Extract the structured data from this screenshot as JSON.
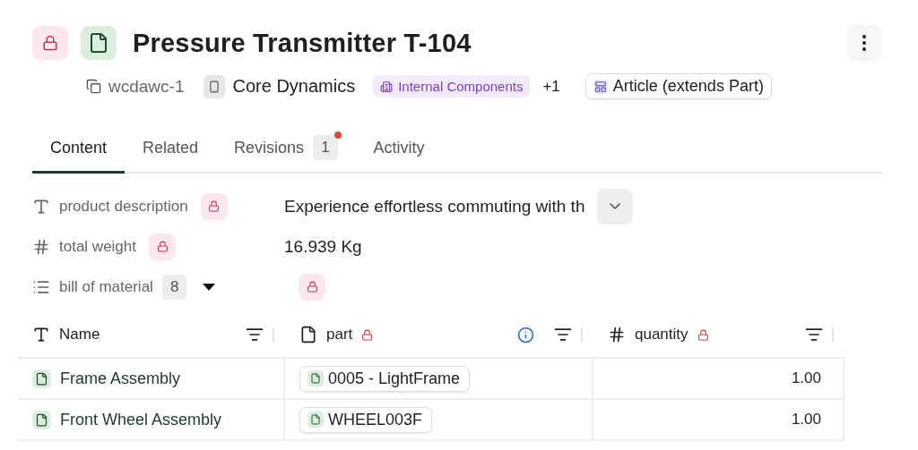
{
  "header": {
    "locked": true,
    "title": "Pressure Transmitter T-104"
  },
  "meta": {
    "id": "wcdawc-1",
    "company": "Core Dynamics",
    "tag": "Internal Components",
    "more": "+1",
    "type": "Article (extends Part)"
  },
  "tabs": [
    {
      "label": "Content",
      "selected": true
    },
    {
      "label": "Related",
      "selected": false
    },
    {
      "label": "Revisions",
      "selected": false,
      "count": "1",
      "notification": true
    },
    {
      "label": "Activity",
      "selected": false
    }
  ],
  "fields": [
    {
      "kind": "text",
      "label": "product description",
      "locked": true,
      "value": "Experience effortless commuting with th"
    },
    {
      "kind": "number",
      "label": "total weight",
      "locked": true,
      "value": "16.939 Kg"
    },
    {
      "kind": "list",
      "label": "bill of material",
      "locked": true,
      "count": "8"
    }
  ],
  "table": {
    "columns": [
      {
        "kind": "text",
        "label": "Name",
        "locked": false
      },
      {
        "kind": "reference",
        "label": "part",
        "locked": true
      },
      {
        "kind": "number",
        "label": "quantity",
        "locked": true
      }
    ],
    "rows": [
      {
        "name": "Frame Assembly",
        "part": "0005 - LightFrame",
        "quantity": "1.00"
      },
      {
        "name": "Front Wheel Assembly",
        "part": "WHEEL003F",
        "quantity": "1.00"
      }
    ]
  }
}
